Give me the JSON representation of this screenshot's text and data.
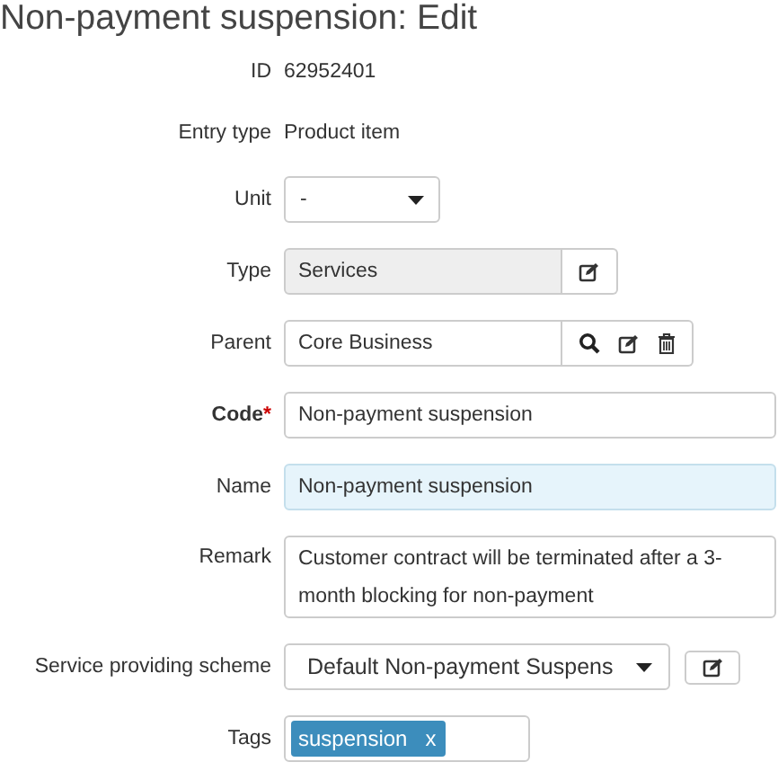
{
  "title": "Non-payment suspension: Edit",
  "fields": [
    {
      "kind": "text",
      "label": "ID",
      "value": "62952401"
    },
    {
      "kind": "text",
      "label": "Entry type",
      "value": "Product item"
    },
    {
      "kind": "select",
      "label": "Unit",
      "value": "-"
    },
    {
      "kind": "readonly",
      "label": "Type",
      "value": "Services",
      "actions": [
        {
          "kind": "edit"
        }
      ]
    },
    {
      "kind": "lookup",
      "label": "Parent",
      "value": "Core Business",
      "actions": [
        {
          "kind": "search"
        },
        {
          "kind": "edit"
        },
        {
          "kind": "delete"
        }
      ]
    },
    {
      "kind": "input",
      "label": "Code",
      "required": true,
      "required_mark": "*",
      "value": "Non-payment suspension",
      "highlighted": false
    },
    {
      "kind": "input",
      "label": "Name",
      "required": false,
      "value": "Non-payment suspension",
      "highlighted": true
    },
    {
      "kind": "textarea",
      "label": "Remark",
      "value": "Customer contract will be terminated after a 3-month blocking for non-payment"
    },
    {
      "kind": "scheme",
      "label": "Service providing scheme",
      "value": "Default Non-payment Suspens"
    },
    {
      "kind": "tags",
      "label": "Tags",
      "tags": [
        {
          "text": "suspension",
          "remove": "x"
        }
      ]
    }
  ]
}
